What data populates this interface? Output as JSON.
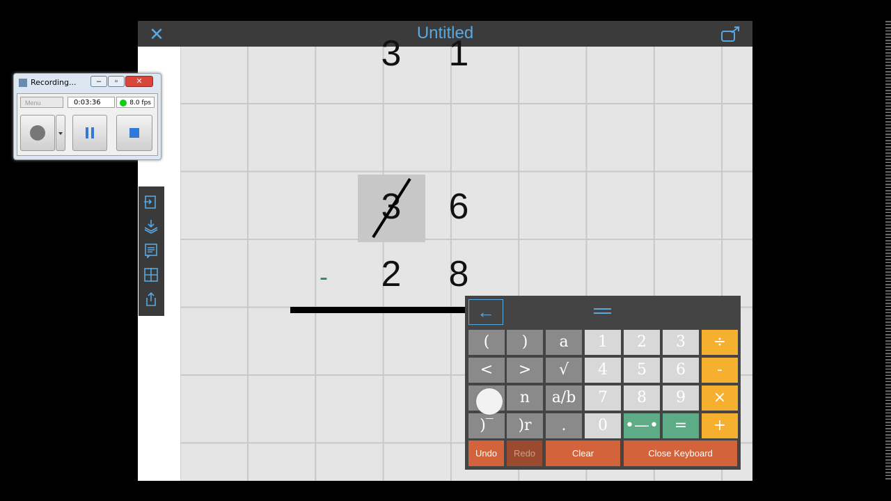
{
  "app": {
    "title": "Untitled",
    "accent": "#5aa8e0"
  },
  "worksheet": {
    "top_row": [
      "3",
      "1"
    ],
    "minuend": [
      "3",
      "6"
    ],
    "subtrahend_sign": "-",
    "subtrahend": [
      "2",
      "8"
    ]
  },
  "sidebar": {
    "icons": [
      "import-icon",
      "layers-icon",
      "notes-icon",
      "grid-icon",
      "export-icon"
    ]
  },
  "keyboard": {
    "back_label": "←",
    "rows": [
      [
        {
          "label": "(",
          "style": "gray"
        },
        {
          "label": ")",
          "style": "gray"
        },
        {
          "label": "a",
          "style": "gray"
        },
        {
          "label": "1",
          "style": "light"
        },
        {
          "label": "2",
          "style": "light"
        },
        {
          "label": "3",
          "style": "light"
        },
        {
          "label": "÷",
          "style": "orange"
        }
      ],
      [
        {
          "label": "<",
          "style": "gray"
        },
        {
          "label": ">",
          "style": "gray"
        },
        {
          "label": "√",
          "style": "gray"
        },
        {
          "label": "4",
          "style": "light"
        },
        {
          "label": "5",
          "style": "light"
        },
        {
          "label": "6",
          "style": "light"
        },
        {
          "label": "-",
          "style": "orange"
        }
      ],
      [
        {
          "label": "",
          "style": "gray"
        },
        {
          "label": "n",
          "style": "gray"
        },
        {
          "label": "a/b",
          "style": "gray"
        },
        {
          "label": "7",
          "style": "light"
        },
        {
          "label": "8",
          "style": "light"
        },
        {
          "label": "9",
          "style": "light"
        },
        {
          "label": "×",
          "style": "orange"
        }
      ],
      [
        {
          "label": ")‾",
          "style": "gray"
        },
        {
          "label": ")r",
          "style": "gray"
        },
        {
          "label": ".",
          "style": "gray"
        },
        {
          "label": "0",
          "style": "light"
        },
        {
          "label": "•—•",
          "style": "green"
        },
        {
          "label": "=",
          "style": "green"
        },
        {
          "label": "+",
          "style": "orange"
        }
      ]
    ],
    "undo": "Undo",
    "redo": "Redo",
    "clear": "Clear",
    "close": "Close Keyboard"
  },
  "recorder": {
    "title": "Recording...",
    "menu": "Menu",
    "time": "0:03:36",
    "fps": "8.0 fps"
  }
}
